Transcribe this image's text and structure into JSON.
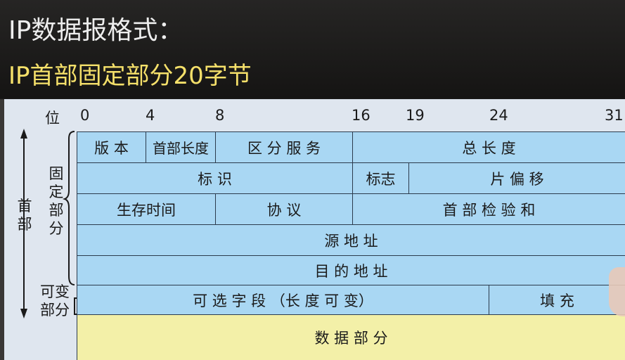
{
  "header": {
    "title": "IP数据报格式：",
    "subtitle": "IP首部固定部分20字节"
  },
  "diagram": {
    "bit_label": "位",
    "ticks": [
      "0",
      "4",
      "8",
      "16",
      "19",
      "24",
      "31"
    ],
    "left_labels": {
      "header": "首部",
      "fixed": "固定部分",
      "variable": "可变部分"
    },
    "rows": [
      {
        "cells": [
          "版 本",
          "首部长度",
          "区 分 服 务",
          "总 长 度"
        ]
      },
      {
        "cells": [
          "标 识",
          "标志",
          "片 偏 移"
        ]
      },
      {
        "cells": [
          "生存时间",
          "协 议",
          "首 部 检 验 和"
        ]
      },
      {
        "cells": [
          "源 地 址"
        ]
      },
      {
        "cells": [
          "目 的 地 址"
        ]
      },
      {
        "cells": [
          "可 选 字 段 （长 度 可 变）",
          "填 充"
        ]
      },
      {
        "cells": [
          "数 据 部 分"
        ]
      }
    ],
    "colors": {
      "header_fill": "#a9d7f3",
      "data_fill": "#f3f0a8",
      "background": "#dfe6ef"
    }
  }
}
